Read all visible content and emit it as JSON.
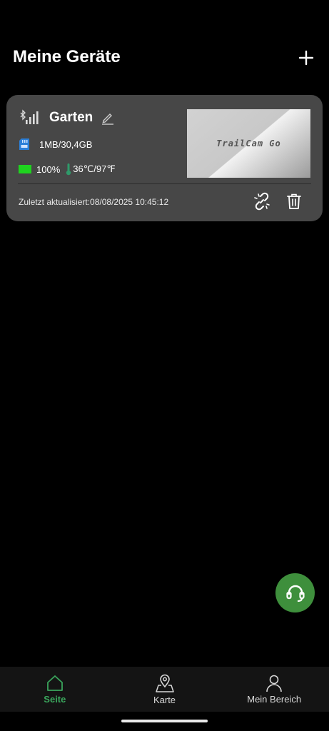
{
  "header": {
    "title": "Meine Geräte"
  },
  "device": {
    "name": "Garten",
    "storage": "1MB/30,4GB",
    "battery": "100%",
    "temperature": "36℃/97℉",
    "preview_text": "TrailCam Go",
    "last_updated": "Zuletzt aktualisiert:08/08/2025 10:45:12"
  },
  "nav": {
    "items": [
      {
        "label": "Seite",
        "icon": "home-icon",
        "active": true
      },
      {
        "label": "Karte",
        "icon": "map-pin-icon",
        "active": false
      },
      {
        "label": "Mein Bereich",
        "icon": "person-icon",
        "active": false
      }
    ]
  },
  "colors": {
    "accent": "#3aa55c",
    "fab": "#3e8f3c",
    "card": "#474747",
    "battery": "#1fd41f",
    "sd": "#2b7fd8"
  }
}
